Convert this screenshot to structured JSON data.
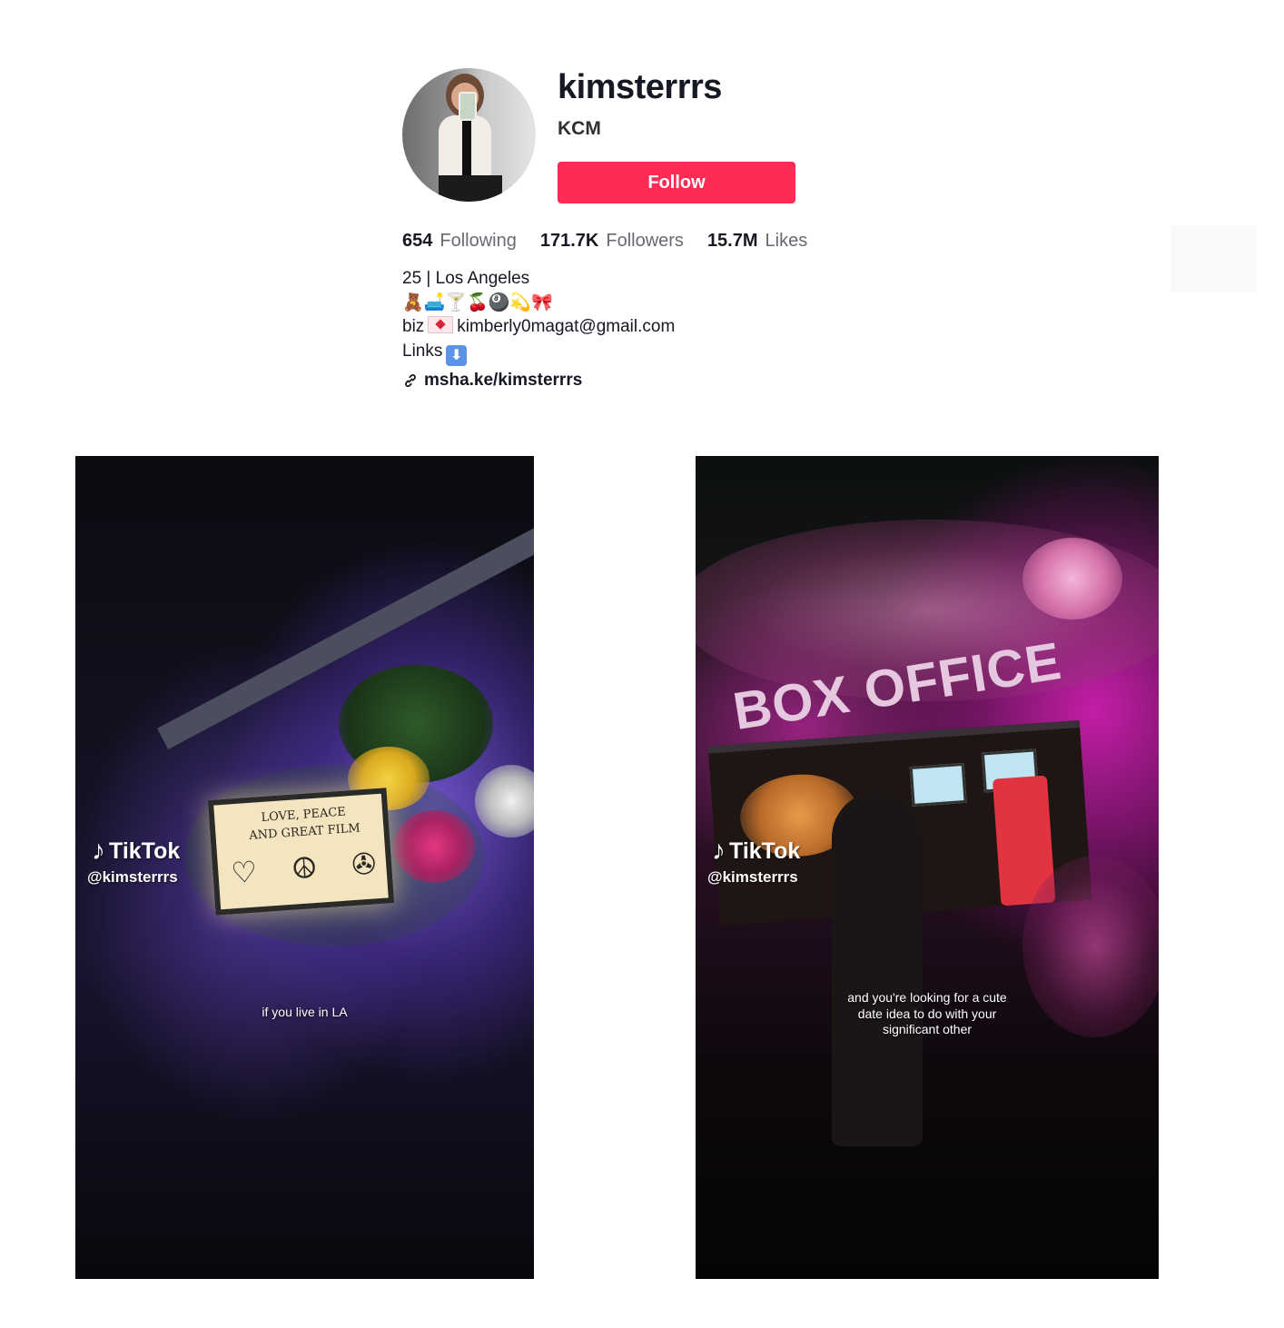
{
  "profile": {
    "username": "kimsterrrs",
    "nickname": "KCM",
    "follow_label": "Follow",
    "accent_color": "#fe2c55"
  },
  "stats": [
    {
      "value": "654",
      "label": "Following"
    },
    {
      "value": "171.7K",
      "label": "Followers"
    },
    {
      "value": "15.7M",
      "label": "Likes"
    }
  ],
  "bio": {
    "line1": "25 | Los Angeles",
    "emoji_line": "🧸🛋️🍸🍒🎱💫🎀",
    "biz_prefix": "biz",
    "biz_email": "kimberly0magat@gmail.com",
    "links_label": "Links",
    "links_icon": "down-arrow-icon"
  },
  "link": {
    "icon": "link-icon",
    "text": "msha.ke/kimsterrrs"
  },
  "videos": [
    {
      "watermark_brand": "TikTok",
      "watermark_handle": "@kimsterrrs",
      "sign_line1": "LOVE, PEACE",
      "sign_line2": "AND GREAT FILM",
      "caption": "if you live in LA"
    },
    {
      "watermark_brand": "TikTok",
      "watermark_handle": "@kimsterrrs",
      "sign_text": "BOX OFFICE",
      "caption_line1": "and you're looking for a cute",
      "caption_line2": "date idea to do with your",
      "caption_line3": "significant other"
    }
  ]
}
